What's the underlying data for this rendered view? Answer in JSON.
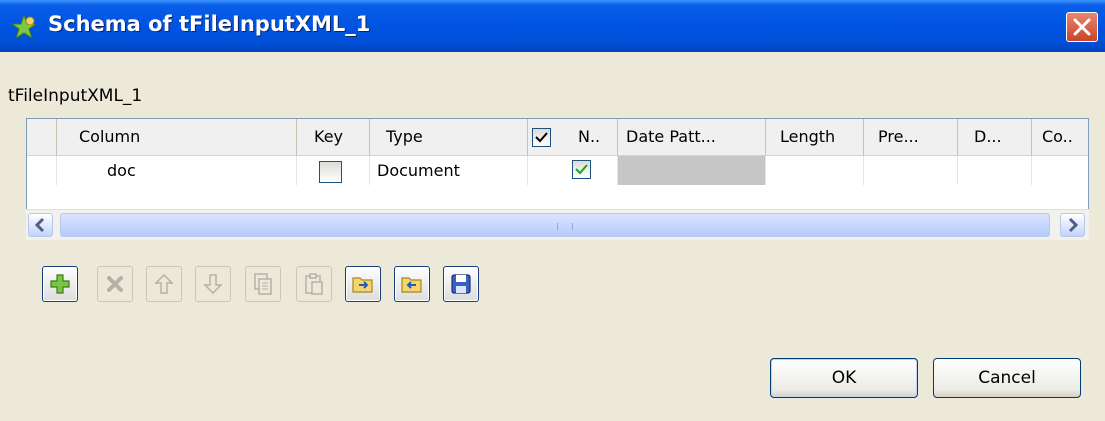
{
  "window": {
    "title": "Schema of tFileInputXML_1"
  },
  "component_name": "tFileInputXML_1",
  "table": {
    "columns": [
      "Column",
      "Key",
      "Type",
      "N..",
      "Date Patt...",
      "Length",
      "Pre...",
      "D...",
      "Co.."
    ],
    "nullable_header_checked": true,
    "rows": [
      {
        "column": "doc",
        "key": false,
        "type": "Document",
        "nullable": true,
        "date_pattern": "",
        "length": "",
        "precision": "",
        "default": "",
        "comment": ""
      }
    ]
  },
  "toolbar": {
    "add": "add-icon",
    "remove": "delete-icon",
    "move_up": "arrow-up-icon",
    "move_down": "arrow-down-icon",
    "copy": "copy-icon",
    "paste": "paste-icon",
    "import": "import-schema-icon",
    "export": "export-schema-icon",
    "save": "save-icon"
  },
  "buttons": {
    "ok": "OK",
    "cancel": "Cancel"
  },
  "colors": {
    "titlebar": "#0054e3",
    "face": "#ece9d8",
    "close": "#c8452a"
  }
}
